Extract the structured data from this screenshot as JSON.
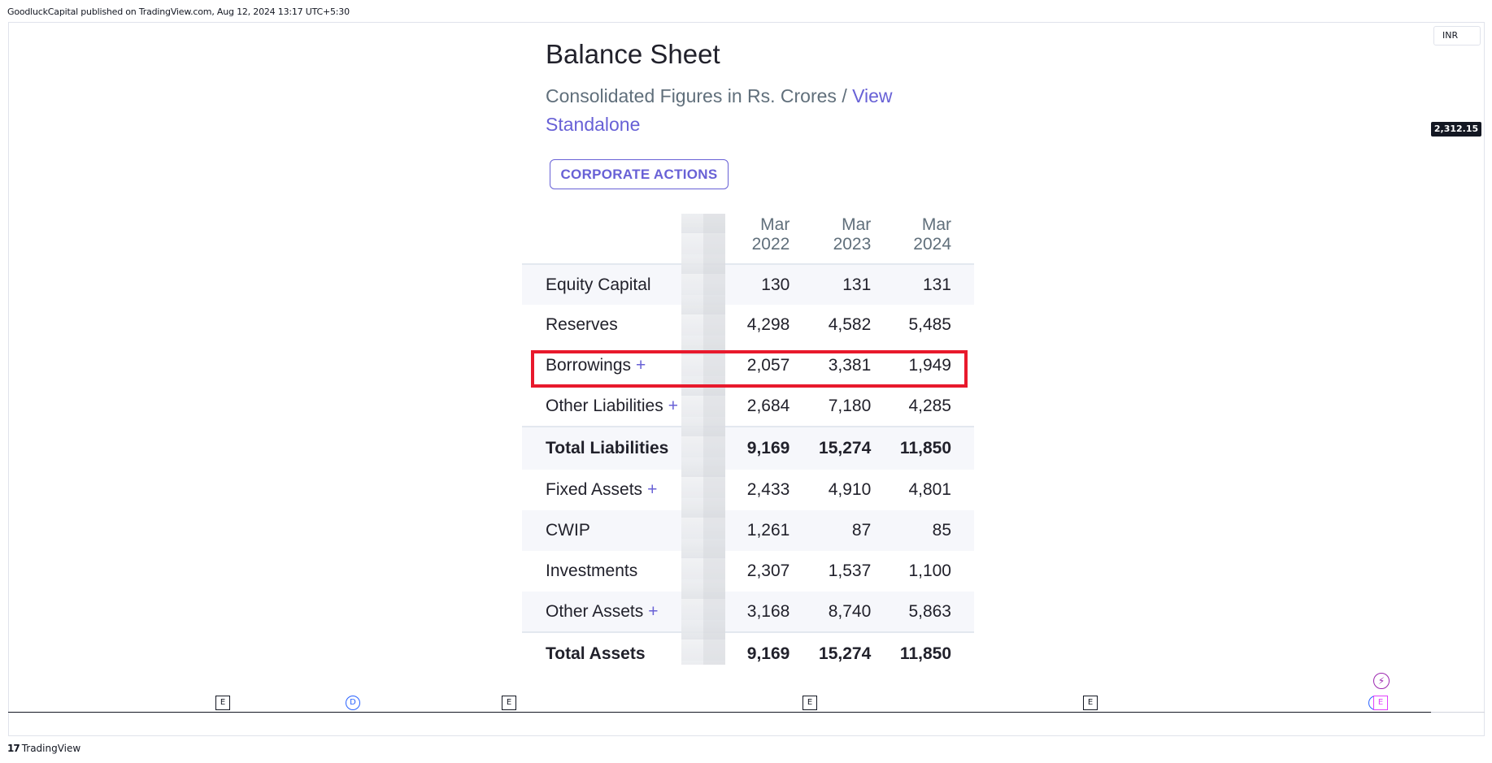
{
  "header": {
    "published_text": "GoodluckCapital published on TradingView.com, Aug 12, 2024 13:17 UTC+5:30"
  },
  "chart": {
    "currency": "INR",
    "last_price": "2,312.15"
  },
  "sheet": {
    "title": "Balance Sheet",
    "subtitle_text": "Consolidated Figures in Rs. Crores / ",
    "subtitle_link": "View Standalone",
    "corporate_actions_label": "CORPORATE ACTIONS",
    "columns": [
      {
        "month": "Mar",
        "year": "2022"
      },
      {
        "month": "Mar",
        "year": "2023"
      },
      {
        "month": "Mar",
        "year": "2024"
      }
    ],
    "rows": [
      {
        "label": "Equity Capital",
        "plus": "",
        "values": [
          "130",
          "131",
          "131"
        ]
      },
      {
        "label": "Reserves",
        "plus": "",
        "values": [
          "4,298",
          "4,582",
          "5,485"
        ]
      },
      {
        "label": "Borrowings",
        "plus": "+",
        "values": [
          "2,057",
          "3,381",
          "1,949"
        ]
      },
      {
        "label": "Other Liabilities",
        "plus": "+",
        "values": [
          "2,684",
          "7,180",
          "4,285"
        ]
      },
      {
        "label": "Total Liabilities",
        "plus": "",
        "values": [
          "9,169",
          "15,274",
          "11,850"
        ]
      },
      {
        "label": "Fixed Assets",
        "plus": "+",
        "values": [
          "2,433",
          "4,910",
          "4,801"
        ]
      },
      {
        "label": "CWIP",
        "plus": "",
        "values": [
          "1,261",
          "87",
          "85"
        ]
      },
      {
        "label": "Investments",
        "plus": "",
        "values": [
          "2,307",
          "1,537",
          "1,100"
        ]
      },
      {
        "label": "Other Assets",
        "plus": "+",
        "values": [
          "3,168",
          "8,740",
          "5,863"
        ]
      },
      {
        "label": "Total Assets",
        "plus": "",
        "values": [
          "9,169",
          "15,274",
          "11,850"
        ]
      }
    ]
  },
  "markers": {
    "earnings_label": "E",
    "dividend_label": "D",
    "bolt_glyph": "⚡"
  },
  "footer": {
    "logo_mark": "17",
    "logo_text": "TradingView"
  }
}
